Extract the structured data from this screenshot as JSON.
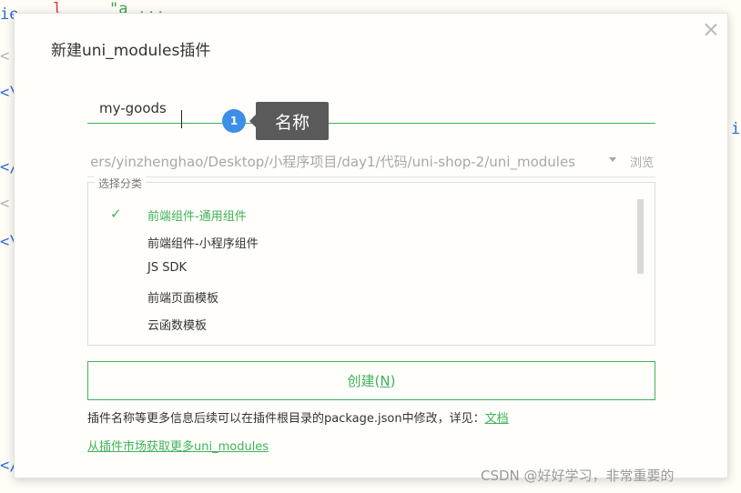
{
  "editor": {
    "frag_top_left": "ie",
    "frag_top_red": "l",
    "frag_top_green": "\"a ...",
    "gutter": [
      "<",
      "<\\",
      "</",
      "<",
      "<\\",
      "</"
    ],
    "frag_right": "i"
  },
  "dialog": {
    "title": "新建uni_modules插件",
    "name_input": {
      "value": "my-goods",
      "placeholder": ""
    },
    "step_badge": "1",
    "tooltip": "名称",
    "path": {
      "value": "ers/yinzhenghao/Desktop/小程序项目/day1/代码/uni-shop-2/uni_modules",
      "browse_label": "浏览"
    },
    "category": {
      "legend": "选择分类",
      "items": [
        {
          "label": "前端组件-通用组件",
          "selected": true
        },
        {
          "label": "前端组件-小程序组件",
          "selected": false
        },
        {
          "label": "JS SDK",
          "selected": false
        },
        {
          "label": "前端页面模板",
          "selected": false
        },
        {
          "label": "云函数模板",
          "selected": false
        }
      ],
      "check_glyph": "✓"
    },
    "create_label_prefix": "创建(",
    "create_label_key": "N",
    "create_label_suffix": ")",
    "hint_text": "插件名称等更多信息后续可以在插件根目录的package.json中修改，详见：",
    "hint_link": "文档",
    "market_link": "从插件市场获取更多uni_modules"
  },
  "watermark": "CSDN @好好学习，非常重要的",
  "colors": {
    "accent": "#3fb25c",
    "badge": "#3c8ee8",
    "tooltip_bg": "#5a5a5a"
  }
}
